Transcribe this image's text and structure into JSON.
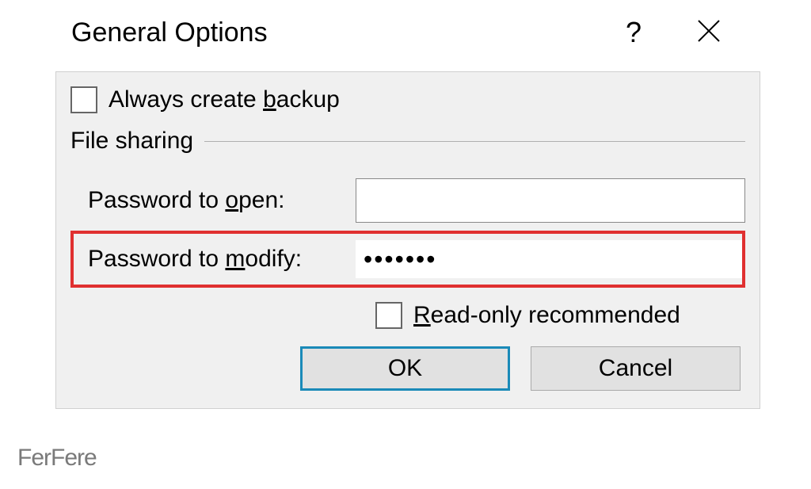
{
  "dialog": {
    "title": "General Options",
    "backup_checkbox": {
      "label_pre": "Always create ",
      "label_u": "b",
      "label_post": "ackup",
      "checked": false
    },
    "section_label": "File sharing",
    "password_open": {
      "label_pre": "Password to ",
      "label_u": "o",
      "label_post": "pen:",
      "value": ""
    },
    "password_modify": {
      "label_pre": "Password to ",
      "label_u": "m",
      "label_post": "odify:",
      "value": "•••••••"
    },
    "readonly_checkbox": {
      "label_u": "R",
      "label_post": "ead-only recommended",
      "checked": false
    },
    "ok_button": "OK",
    "cancel_button": "Cancel"
  },
  "watermark": "FerFere"
}
